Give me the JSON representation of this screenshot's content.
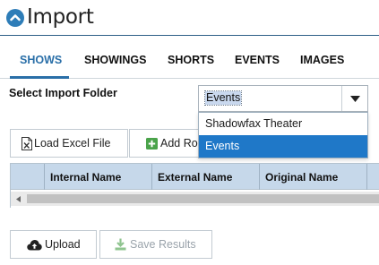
{
  "header": {
    "title": "Import",
    "icon": "chevron-up-circle-icon",
    "accent": "#2e7db8"
  },
  "tabs": [
    {
      "label": "SHOWS",
      "active": true
    },
    {
      "label": "SHOWINGS",
      "active": false
    },
    {
      "label": "SHORTS",
      "active": false
    },
    {
      "label": "EVENTS",
      "active": false
    },
    {
      "label": "IMAGES",
      "active": false
    }
  ],
  "folder": {
    "label": "Select Import Folder",
    "selected": "Events",
    "options": [
      "Shadowfax Theater",
      "Events"
    ],
    "selected_index": 1
  },
  "toolbar": {
    "load_excel": "Load Excel File",
    "add_row": "Add Ro",
    "load_icon": "excel-file-icon",
    "add_icon": "plus-square-icon"
  },
  "grid": {
    "columns": [
      "",
      "Internal Name",
      "External Name",
      "Original Name"
    ]
  },
  "actions": {
    "upload": "Upload",
    "save_results": "Save Results",
    "upload_icon": "cloud-upload-icon",
    "save_icon": "download-icon"
  },
  "colors": {
    "tab_active": "#2a6fa8",
    "header_row": "#c6d8ea",
    "selected_option": "#1f78c8"
  }
}
